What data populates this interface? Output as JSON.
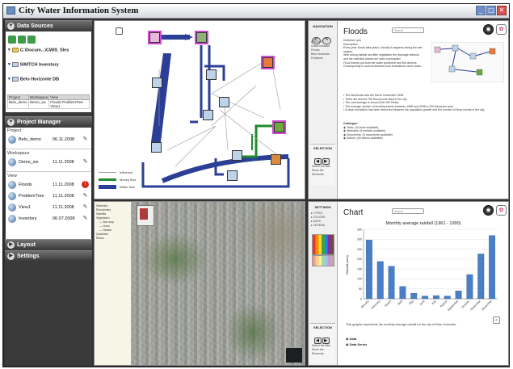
{
  "window": {
    "title": "City Water Information System",
    "buttons": {
      "minimize": "_",
      "maximize": "□",
      "close": "✕"
    }
  },
  "left_panel": {
    "data_sources": {
      "header": "Data Sources",
      "items": [
        {
          "label": "C:\\Docum...\\CWIS_files",
          "icon": "folder-icon"
        },
        {
          "label": "SWITCH Inventory",
          "icon": "database-icon"
        },
        {
          "label": "Belo Horizonte DB",
          "icon": "database-icon"
        }
      ],
      "table": {
        "columns": [
          "Project",
          "Workspace",
          "View"
        ],
        "rows": [
          [
            "Belo_demo",
            "Demo_ws",
            "Floods ProblemTree View1"
          ]
        ]
      }
    },
    "project_manager": {
      "header": "Project Manager",
      "project_label": "Project",
      "projects": [
        {
          "name": "Belo_demo",
          "date": "06.11.2008"
        }
      ],
      "workspace_label": "Workspace",
      "workspaces": [
        {
          "name": "Demo_ws",
          "date": "11.11.2008"
        }
      ],
      "view_label": "View",
      "views": [
        {
          "name": "Floods",
          "date": "11.11.2008"
        },
        {
          "name": "ProblemTree",
          "date": "11.11.2008"
        },
        {
          "name": "View1",
          "date": "11.11.2008"
        },
        {
          "name": "Inventory",
          "date": "06.07.2008"
        }
      ]
    },
    "layout_header": "Layout",
    "settings_header": "Settings"
  },
  "workflow": {
    "legend": {
      "influence": "Influence",
      "money_flow": "Money flow",
      "water_flow": "Water flow"
    },
    "colors": {
      "water": "#2b3f96",
      "money": "#1f8a2e",
      "influence": "#999999"
    }
  },
  "floods_panel": {
    "navigation_label": "NAVIGATION",
    "nav_items": [
      "HISTORY",
      "Guest Initiative",
      "Floods",
      "Belo Horizonte Problems"
    ],
    "title": "Floods",
    "search_placeholder": "Search",
    "body_lines": [
      "Definition: yes",
      "Description:",
      "Every year floods take place. Usually it happens during the wet season.",
      "With strong rainfall and little vegetation the drainage network and the retention basins are often overloaded.",
      "Flood events put both the water workforce and the citizens.",
      "Consequently in several districts flood inundations were made.",
      "",
      "• The last floods was the first in December 2008.",
      "• There are around 750 flood prone sites in the city.",
      "• The cost average is around 400 000 Reais.",
      "• The average number of flooding events between 1998 and 2008 is 200 floods per year.",
      "• A clear correlation has been observed between the population growth and the number of flood events in the city.",
      "",
      "Catalogue:",
      "◉ Texts: (10 texts available)",
      "◉ Websites: (8 website available)",
      "◉ Documents: (5 documents available)",
      "◉ Videos: (40 videos available)"
    ],
    "selection_label": "SELECTION",
    "selection_rows": [
      "Select the filter",
      "Show the Elements"
    ]
  },
  "map_panel": {
    "layers": [
      "Selection",
      "Pluviometry",
      "Satellite",
      "Vegetation",
      "— Bus stop",
      "— Lines",
      "— Station",
      "Quadrant",
      "Rivers"
    ]
  },
  "chart_panel": {
    "settings_label": "SETTINGS",
    "settings_items": [
      "TYPES",
      "COLORS",
      "AXES",
      "LEGEND"
    ],
    "title": "Chart",
    "search_placeholder": "Search",
    "caption": "This graphic represents the monthly average rainfall for the city of Belo Horizonte.",
    "options": [
      "Data",
      "Data Series"
    ],
    "selection_label": "SELECTION",
    "selection_rows": [
      "Select the filter",
      "Show the Elements"
    ],
    "bar_color": "#4a7fc6"
  },
  "chart_data": {
    "type": "bar",
    "title": "Monthly average rainfall (1961 - 1990)",
    "xlabel": "",
    "ylabel": "Rainfall (mm)",
    "ylim": [
      0,
      350
    ],
    "yticks": [
      0,
      50,
      100,
      150,
      200,
      250,
      300,
      350
    ],
    "categories": [
      "January",
      "February",
      "March",
      "April",
      "May",
      "June",
      "July",
      "August",
      "September",
      "October",
      "November",
      "December"
    ],
    "values": [
      296,
      188,
      164,
      62,
      28,
      14,
      16,
      14,
      40,
      122,
      226,
      319
    ]
  }
}
